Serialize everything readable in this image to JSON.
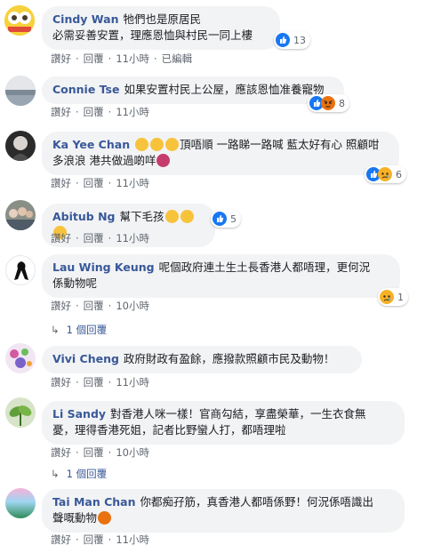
{
  "comments": [
    {
      "name": "Cindy Wan",
      "text_line1": "牠們也是原居民",
      "text_line2": "必需妥善安置，理應恩恤與村民一同上樓",
      "actions": [
        "讚好",
        "回覆",
        "11小時",
        "已編輯"
      ],
      "reactions": {
        "icons": [
          "like-icon"
        ],
        "count": "13"
      }
    },
    {
      "name": "Connie Tse",
      "text_line1": "如果安置村民上公屋，應該恩恤准養寵物",
      "actions": [
        "讚好",
        "回覆",
        "11小時"
      ],
      "reactions": {
        "icons": [
          "like-icon",
          "angry-icon"
        ],
        "count": "8"
      }
    },
    {
      "name": "Ka Yee Chan",
      "text_line1": "頂唔順 一路睇一路喊 藍太好有心 照顧咁",
      "text_line2": "多浪浪 港共做過啲咩",
      "actions": [
        "讚好",
        "回覆",
        "11小時"
      ],
      "reactions": {
        "icons": [
          "like-icon",
          "sad-icon"
        ],
        "count": "6"
      }
    },
    {
      "name": "Abitub Ng",
      "text_line1": "幫下毛孩",
      "actions": [
        "讚好",
        "回覆",
        "11小時"
      ],
      "reactions": {
        "icons": [
          "like-icon"
        ],
        "count": "5"
      }
    },
    {
      "name": "Lau Wing Keung",
      "text_line1": "呢個政府連土生土長香港人都唔理，更何況",
      "text_line2": "係動物呢",
      "actions": [
        "讚好",
        "回覆",
        "10小時"
      ],
      "reactions": {
        "icons": [
          "sad-icon"
        ],
        "count": "1"
      },
      "replies_label": "1 個回覆"
    },
    {
      "name": "Vivi Cheng",
      "text_line1": "政府財政有盈餘，應撥款照顧市民及動物！",
      "actions": [
        "讚好",
        "回覆",
        "11小時"
      ]
    },
    {
      "name": "Li Sandy",
      "text_line1": "對香港人咪一樣！官商勾結，享盡榮華，一生衣食無",
      "text_line2": "憂，理得香港死姐，記者比野蠻人打，都唔理啦",
      "actions": [
        "讚好",
        "回覆",
        "10小時"
      ],
      "replies_label": "1 個回覆"
    },
    {
      "name": "Tai Man Chan",
      "text_line1": "你都痴孖筋，真香港人都唔係野！何況係唔識出",
      "text_line2": "聲嘅動物",
      "actions": [
        "讚好",
        "回覆",
        "11小時"
      ]
    }
  ],
  "colors": {
    "name": "#385898",
    "bubble": "#f2f3f5",
    "meta": "#606770",
    "like": "#1877f2",
    "angry": "#e9710f",
    "sad": "#f7b125"
  }
}
